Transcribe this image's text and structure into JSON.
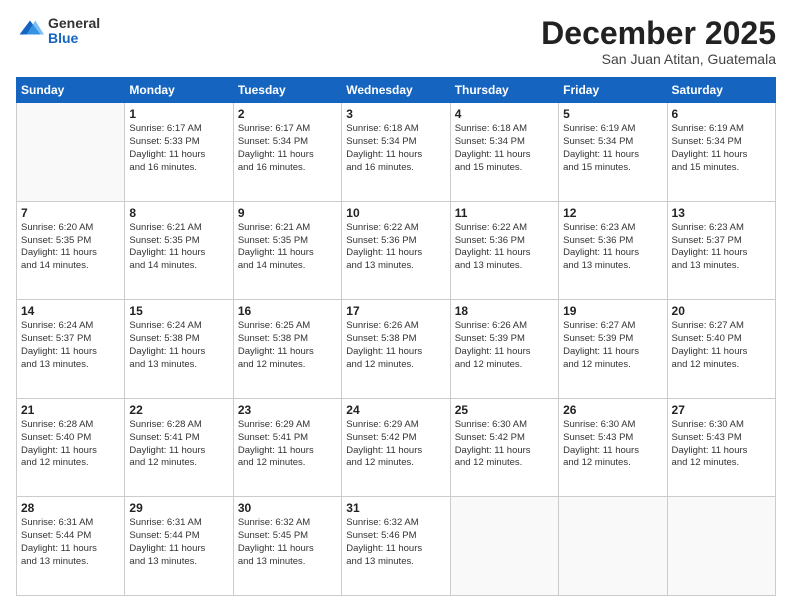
{
  "logo": {
    "general": "General",
    "blue": "Blue"
  },
  "title": "December 2025",
  "location": "San Juan Atitan, Guatemala",
  "headers": [
    "Sunday",
    "Monday",
    "Tuesday",
    "Wednesday",
    "Thursday",
    "Friday",
    "Saturday"
  ],
  "weeks": [
    [
      {
        "day": "",
        "info": ""
      },
      {
        "day": "1",
        "info": "Sunrise: 6:17 AM\nSunset: 5:33 PM\nDaylight: 11 hours\nand 16 minutes."
      },
      {
        "day": "2",
        "info": "Sunrise: 6:17 AM\nSunset: 5:34 PM\nDaylight: 11 hours\nand 16 minutes."
      },
      {
        "day": "3",
        "info": "Sunrise: 6:18 AM\nSunset: 5:34 PM\nDaylight: 11 hours\nand 16 minutes."
      },
      {
        "day": "4",
        "info": "Sunrise: 6:18 AM\nSunset: 5:34 PM\nDaylight: 11 hours\nand 15 minutes."
      },
      {
        "day": "5",
        "info": "Sunrise: 6:19 AM\nSunset: 5:34 PM\nDaylight: 11 hours\nand 15 minutes."
      },
      {
        "day": "6",
        "info": "Sunrise: 6:19 AM\nSunset: 5:34 PM\nDaylight: 11 hours\nand 15 minutes."
      }
    ],
    [
      {
        "day": "7",
        "info": "Sunrise: 6:20 AM\nSunset: 5:35 PM\nDaylight: 11 hours\nand 14 minutes."
      },
      {
        "day": "8",
        "info": "Sunrise: 6:21 AM\nSunset: 5:35 PM\nDaylight: 11 hours\nand 14 minutes."
      },
      {
        "day": "9",
        "info": "Sunrise: 6:21 AM\nSunset: 5:35 PM\nDaylight: 11 hours\nand 14 minutes."
      },
      {
        "day": "10",
        "info": "Sunrise: 6:22 AM\nSunset: 5:36 PM\nDaylight: 11 hours\nand 13 minutes."
      },
      {
        "day": "11",
        "info": "Sunrise: 6:22 AM\nSunset: 5:36 PM\nDaylight: 11 hours\nand 13 minutes."
      },
      {
        "day": "12",
        "info": "Sunrise: 6:23 AM\nSunset: 5:36 PM\nDaylight: 11 hours\nand 13 minutes."
      },
      {
        "day": "13",
        "info": "Sunrise: 6:23 AM\nSunset: 5:37 PM\nDaylight: 11 hours\nand 13 minutes."
      }
    ],
    [
      {
        "day": "14",
        "info": "Sunrise: 6:24 AM\nSunset: 5:37 PM\nDaylight: 11 hours\nand 13 minutes."
      },
      {
        "day": "15",
        "info": "Sunrise: 6:24 AM\nSunset: 5:38 PM\nDaylight: 11 hours\nand 13 minutes."
      },
      {
        "day": "16",
        "info": "Sunrise: 6:25 AM\nSunset: 5:38 PM\nDaylight: 11 hours\nand 12 minutes."
      },
      {
        "day": "17",
        "info": "Sunrise: 6:26 AM\nSunset: 5:38 PM\nDaylight: 11 hours\nand 12 minutes."
      },
      {
        "day": "18",
        "info": "Sunrise: 6:26 AM\nSunset: 5:39 PM\nDaylight: 11 hours\nand 12 minutes."
      },
      {
        "day": "19",
        "info": "Sunrise: 6:27 AM\nSunset: 5:39 PM\nDaylight: 11 hours\nand 12 minutes."
      },
      {
        "day": "20",
        "info": "Sunrise: 6:27 AM\nSunset: 5:40 PM\nDaylight: 11 hours\nand 12 minutes."
      }
    ],
    [
      {
        "day": "21",
        "info": "Sunrise: 6:28 AM\nSunset: 5:40 PM\nDaylight: 11 hours\nand 12 minutes."
      },
      {
        "day": "22",
        "info": "Sunrise: 6:28 AM\nSunset: 5:41 PM\nDaylight: 11 hours\nand 12 minutes."
      },
      {
        "day": "23",
        "info": "Sunrise: 6:29 AM\nSunset: 5:41 PM\nDaylight: 11 hours\nand 12 minutes."
      },
      {
        "day": "24",
        "info": "Sunrise: 6:29 AM\nSunset: 5:42 PM\nDaylight: 11 hours\nand 12 minutes."
      },
      {
        "day": "25",
        "info": "Sunrise: 6:30 AM\nSunset: 5:42 PM\nDaylight: 11 hours\nand 12 minutes."
      },
      {
        "day": "26",
        "info": "Sunrise: 6:30 AM\nSunset: 5:43 PM\nDaylight: 11 hours\nand 12 minutes."
      },
      {
        "day": "27",
        "info": "Sunrise: 6:30 AM\nSunset: 5:43 PM\nDaylight: 11 hours\nand 12 minutes."
      }
    ],
    [
      {
        "day": "28",
        "info": "Sunrise: 6:31 AM\nSunset: 5:44 PM\nDaylight: 11 hours\nand 13 minutes."
      },
      {
        "day": "29",
        "info": "Sunrise: 6:31 AM\nSunset: 5:44 PM\nDaylight: 11 hours\nand 13 minutes."
      },
      {
        "day": "30",
        "info": "Sunrise: 6:32 AM\nSunset: 5:45 PM\nDaylight: 11 hours\nand 13 minutes."
      },
      {
        "day": "31",
        "info": "Sunrise: 6:32 AM\nSunset: 5:46 PM\nDaylight: 11 hours\nand 13 minutes."
      },
      {
        "day": "",
        "info": ""
      },
      {
        "day": "",
        "info": ""
      },
      {
        "day": "",
        "info": ""
      }
    ]
  ]
}
